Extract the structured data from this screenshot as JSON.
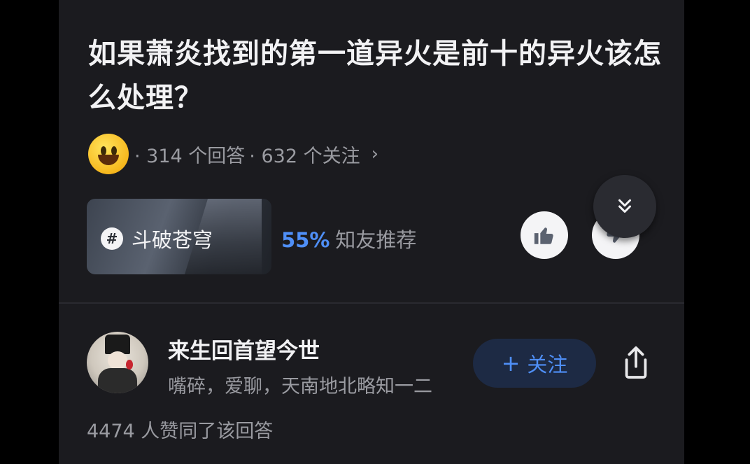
{
  "question": {
    "title": "如果萧炎找到的第一道异火是前十的异火该怎么处理？",
    "meta_answers": "· 314 个回答",
    "meta_followers": "· 632 个关注",
    "chevron": "›"
  },
  "topic": {
    "hash": "#",
    "label": "斗破苍穹"
  },
  "recommend": {
    "percent": "55%",
    "label": "知友推荐"
  },
  "answer": {
    "author_name": "来生回首望今世",
    "author_bio": "嘴碎，爱聊，天南地北略知一二",
    "follow_plus": "+",
    "follow_label": "关注",
    "likes_text": "4474 人赞同了该回答"
  },
  "icons": {
    "avatar_emoji": "smiley-icon",
    "vote_up": "thumbs-up-icon",
    "vote_down": "thumbs-down-icon",
    "collapse": "double-chevron-down-icon",
    "share": "share-icon"
  },
  "colors": {
    "background": "#1b1b1f",
    "accent": "#4f8ff7",
    "muted_text": "#9a9ba1",
    "follow_bg": "#1d2a44"
  }
}
